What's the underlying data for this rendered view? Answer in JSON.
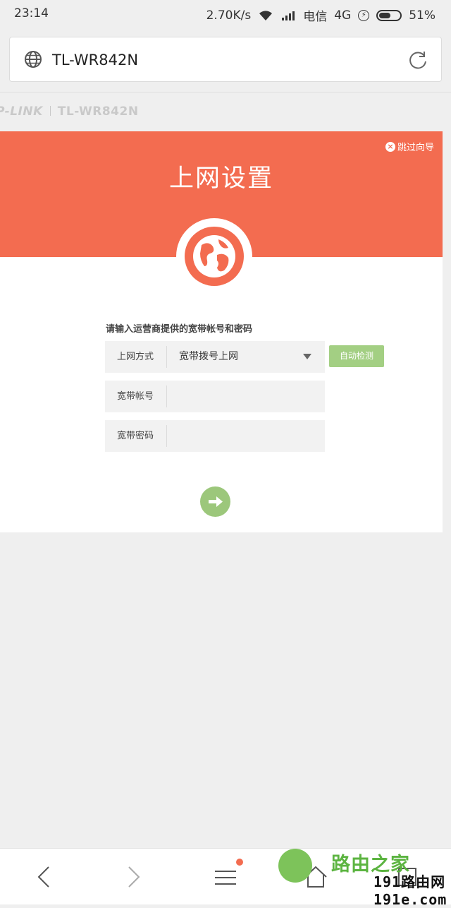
{
  "status_bar": {
    "time": "23:14",
    "speed": "2.70K/s",
    "carrier": "电信",
    "network": "4G",
    "battery": "51%",
    "battery_level": 0.51
  },
  "browser": {
    "url": "TL-WR842N",
    "globe_icon": "globe-icon",
    "reload_icon": "reload-icon"
  },
  "brand": {
    "logo": "P-LINK",
    "model": "TL-WR842N"
  },
  "wizard": {
    "skip_label": "跳过向导",
    "title": "上网设置",
    "prompt": "请输入运营商提供的宽带帐号和密码",
    "fields": [
      {
        "label": "上网方式",
        "value": "宽带拨号上网"
      },
      {
        "label": "宽带帐号",
        "value": ""
      },
      {
        "label": "宽带密码",
        "value": ""
      }
    ],
    "detect_button": "自动检测",
    "accent_color": "#f36c50",
    "button_color": "#a3cf83"
  },
  "bottom_nav": {
    "items": [
      "back-icon",
      "forward-icon",
      "menu-icon",
      "home-icon",
      "tabs-icon"
    ]
  },
  "watermark": {
    "title": "路由之家",
    "subtitle": "191路由网 191e.com"
  }
}
